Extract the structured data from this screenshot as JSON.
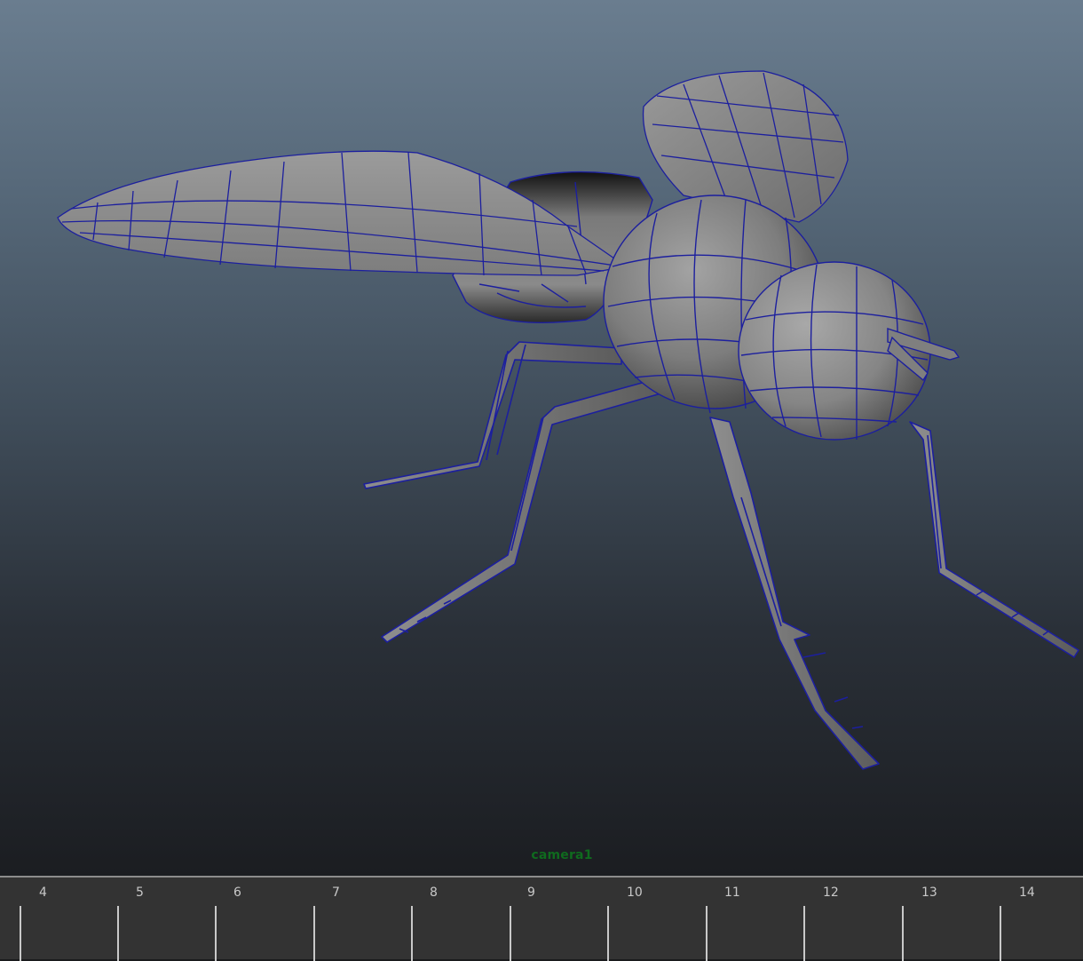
{
  "viewport": {
    "camera_name": "camera1",
    "model": "fly-wireframe",
    "wire_color": "#1c1f9e",
    "camera_label_color": "#0f6b1e"
  },
  "timeline": {
    "frames": [
      "4",
      "5",
      "6",
      "7",
      "8",
      "9",
      "10",
      "11",
      "12",
      "13",
      "14"
    ]
  }
}
